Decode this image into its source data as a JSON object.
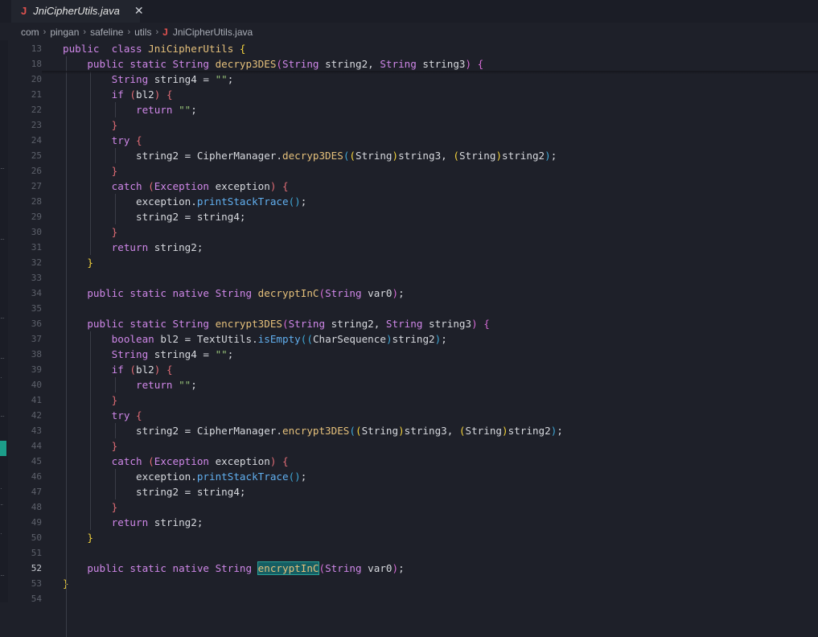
{
  "tab": {
    "icon": "java-file-icon",
    "label": "JniCipherUtils.java",
    "close": "✕"
  },
  "breadcrumb": [
    "com",
    "pingan",
    "safeline",
    "utils",
    "JniCipherUtils.java"
  ],
  "breadcrumb_separator": "›",
  "file_icon_glyph": "J",
  "current_line": "52",
  "lines": [
    {
      "n": "13",
      "t": [
        [
          "kw",
          "public"
        ],
        [
          "",
          "  "
        ],
        [
          "kw",
          "class "
        ],
        [
          "cls",
          "JniCipherUtils "
        ],
        [
          "b1",
          "{"
        ]
      ]
    },
    {
      "n": "18",
      "t": [
        [
          "",
          "    "
        ],
        [
          "kw",
          "public static "
        ],
        [
          "ty",
          "String "
        ],
        [
          "fn",
          "decryp3DES"
        ],
        [
          "b2",
          "("
        ],
        [
          "ty",
          "String "
        ],
        [
          "",
          "string2, "
        ],
        [
          "ty",
          "String "
        ],
        [
          "",
          "string3"
        ],
        [
          "b2",
          ")"
        ],
        [
          "",
          " "
        ],
        [
          "b2",
          "{"
        ]
      ]
    },
    {
      "n": "20",
      "t": [
        [
          "",
          "        "
        ],
        [
          "ty",
          "String "
        ],
        [
          "",
          "string4 = "
        ],
        [
          "str",
          "\"\""
        ],
        [
          "",
          ";"
        ]
      ]
    },
    {
      "n": "21",
      "t": [
        [
          "",
          "        "
        ],
        [
          "kw",
          "if "
        ],
        [
          "br-red",
          "("
        ],
        [
          "",
          "bl2"
        ],
        [
          "br-red",
          ")"
        ],
        [
          "",
          " "
        ],
        [
          "br-red",
          "{"
        ]
      ]
    },
    {
      "n": "22",
      "t": [
        [
          "",
          "            "
        ],
        [
          "kw",
          "return "
        ],
        [
          "str",
          "\"\""
        ],
        [
          "",
          ";"
        ]
      ]
    },
    {
      "n": "23",
      "t": [
        [
          "",
          "        "
        ],
        [
          "br-red",
          "}"
        ]
      ]
    },
    {
      "n": "24",
      "t": [
        [
          "",
          "        "
        ],
        [
          "kw",
          "try "
        ],
        [
          "br-red",
          "{"
        ]
      ]
    },
    {
      "n": "25",
      "t": [
        [
          "",
          "            "
        ],
        [
          "",
          "string2 = CipherManager."
        ],
        [
          "fn",
          "decryp3DES"
        ],
        [
          "b3",
          "("
        ],
        [
          "b1",
          "("
        ],
        [
          "",
          "String"
        ],
        [
          "b1",
          ")"
        ],
        [
          "",
          "string3, "
        ],
        [
          "b1",
          "("
        ],
        [
          "",
          "String"
        ],
        [
          "b1",
          ")"
        ],
        [
          "",
          "string2"
        ],
        [
          "b3",
          ")"
        ],
        [
          "",
          ";"
        ]
      ]
    },
    {
      "n": "26",
      "t": [
        [
          "",
          "        "
        ],
        [
          "br-red",
          "}"
        ]
      ]
    },
    {
      "n": "27",
      "t": [
        [
          "",
          "        "
        ],
        [
          "kw",
          "catch "
        ],
        [
          "br-red",
          "("
        ],
        [
          "ty",
          "Exception "
        ],
        [
          "",
          "exception"
        ],
        [
          "br-red",
          ")"
        ],
        [
          "",
          " "
        ],
        [
          "br-red",
          "{"
        ]
      ]
    },
    {
      "n": "28",
      "t": [
        [
          "",
          "            "
        ],
        [
          "",
          "exception."
        ],
        [
          "mth",
          "printStackTrace"
        ],
        [
          "b3",
          "()"
        ],
        [
          "",
          ";"
        ]
      ]
    },
    {
      "n": "29",
      "t": [
        [
          "",
          "            "
        ],
        [
          "",
          "string2 = string4;"
        ]
      ]
    },
    {
      "n": "30",
      "t": [
        [
          "",
          "        "
        ],
        [
          "br-red",
          "}"
        ]
      ]
    },
    {
      "n": "31",
      "t": [
        [
          "",
          "        "
        ],
        [
          "kw",
          "return "
        ],
        [
          "",
          "string2;"
        ]
      ]
    },
    {
      "n": "32",
      "t": [
        [
          "",
          "    "
        ],
        [
          "b1",
          "}"
        ]
      ]
    },
    {
      "n": "33",
      "t": []
    },
    {
      "n": "34",
      "t": [
        [
          "",
          "    "
        ],
        [
          "kw",
          "public static native "
        ],
        [
          "ty",
          "String "
        ],
        [
          "fn",
          "decryptInC"
        ],
        [
          "b2",
          "("
        ],
        [
          "ty",
          "String "
        ],
        [
          "",
          "var0"
        ],
        [
          "b2",
          ")"
        ],
        [
          "",
          ";"
        ]
      ]
    },
    {
      "n": "35",
      "t": []
    },
    {
      "n": "36",
      "t": [
        [
          "",
          "    "
        ],
        [
          "kw",
          "public static "
        ],
        [
          "ty",
          "String "
        ],
        [
          "fn",
          "encrypt3DES"
        ],
        [
          "b2",
          "("
        ],
        [
          "ty",
          "String "
        ],
        [
          "",
          "string2, "
        ],
        [
          "ty",
          "String "
        ],
        [
          "",
          "string3"
        ],
        [
          "b2",
          ")"
        ],
        [
          "",
          " "
        ],
        [
          "b2",
          "{"
        ]
      ]
    },
    {
      "n": "37",
      "t": [
        [
          "",
          "        "
        ],
        [
          "kw",
          "boolean "
        ],
        [
          "",
          "bl2 = TextUtils."
        ],
        [
          "mth",
          "isEmpty"
        ],
        [
          "b3",
          "("
        ],
        [
          "b3",
          "("
        ],
        [
          "",
          "CharSequence"
        ],
        [
          "b3",
          ")"
        ],
        [
          "",
          "string2"
        ],
        [
          "b3",
          ")"
        ],
        [
          "",
          ";"
        ]
      ]
    },
    {
      "n": "38",
      "t": [
        [
          "",
          "        "
        ],
        [
          "ty",
          "String "
        ],
        [
          "",
          "string4 = "
        ],
        [
          "str",
          "\"\""
        ],
        [
          "",
          ";"
        ]
      ]
    },
    {
      "n": "39",
      "t": [
        [
          "",
          "        "
        ],
        [
          "kw",
          "if "
        ],
        [
          "br-red",
          "("
        ],
        [
          "",
          "bl2"
        ],
        [
          "br-red",
          ")"
        ],
        [
          "",
          " "
        ],
        [
          "br-red",
          "{"
        ]
      ]
    },
    {
      "n": "40",
      "t": [
        [
          "",
          "            "
        ],
        [
          "kw",
          "return "
        ],
        [
          "str",
          "\"\""
        ],
        [
          "",
          ";"
        ]
      ]
    },
    {
      "n": "41",
      "t": [
        [
          "",
          "        "
        ],
        [
          "br-red",
          "}"
        ]
      ]
    },
    {
      "n": "42",
      "t": [
        [
          "",
          "        "
        ],
        [
          "kw",
          "try "
        ],
        [
          "br-red",
          "{"
        ]
      ]
    },
    {
      "n": "43",
      "t": [
        [
          "",
          "            "
        ],
        [
          "",
          "string2 = CipherManager."
        ],
        [
          "fn",
          "encrypt3DES"
        ],
        [
          "b3",
          "("
        ],
        [
          "b1",
          "("
        ],
        [
          "",
          "String"
        ],
        [
          "b1",
          ")"
        ],
        [
          "",
          "string3, "
        ],
        [
          "b1",
          "("
        ],
        [
          "",
          "String"
        ],
        [
          "b1",
          ")"
        ],
        [
          "",
          "string2"
        ],
        [
          "b3",
          ")"
        ],
        [
          "",
          ";"
        ]
      ]
    },
    {
      "n": "44",
      "t": [
        [
          "",
          "        "
        ],
        [
          "br-red",
          "}"
        ]
      ]
    },
    {
      "n": "45",
      "t": [
        [
          "",
          "        "
        ],
        [
          "kw",
          "catch "
        ],
        [
          "br-red",
          "("
        ],
        [
          "ty",
          "Exception "
        ],
        [
          "",
          "exception"
        ],
        [
          "br-red",
          ")"
        ],
        [
          "",
          " "
        ],
        [
          "br-red",
          "{"
        ]
      ]
    },
    {
      "n": "46",
      "t": [
        [
          "",
          "            "
        ],
        [
          "",
          "exception."
        ],
        [
          "mth",
          "printStackTrace"
        ],
        [
          "b3",
          "()"
        ],
        [
          "",
          ";"
        ]
      ]
    },
    {
      "n": "47",
      "t": [
        [
          "",
          "            "
        ],
        [
          "",
          "string2 = string4;"
        ]
      ]
    },
    {
      "n": "48",
      "t": [
        [
          "",
          "        "
        ],
        [
          "br-red",
          "}"
        ]
      ]
    },
    {
      "n": "49",
      "t": [
        [
          "",
          "        "
        ],
        [
          "kw",
          "return "
        ],
        [
          "",
          "string2;"
        ]
      ]
    },
    {
      "n": "50",
      "t": [
        [
          "",
          "    "
        ],
        [
          "b1",
          "}"
        ]
      ]
    },
    {
      "n": "51",
      "t": []
    },
    {
      "n": "52",
      "t": [
        [
          "",
          "    "
        ],
        [
          "kw",
          "public static native "
        ],
        [
          "ty",
          "String "
        ],
        [
          "hl fn",
          "encryptInC"
        ],
        [
          "b2",
          "("
        ],
        [
          "ty",
          "String "
        ],
        [
          "",
          "var0"
        ],
        [
          "b2",
          ")"
        ],
        [
          "",
          ";"
        ]
      ]
    },
    {
      "n": "53",
      "t": [
        [
          "b1",
          "}"
        ]
      ]
    },
    {
      "n": "54",
      "t": []
    }
  ]
}
